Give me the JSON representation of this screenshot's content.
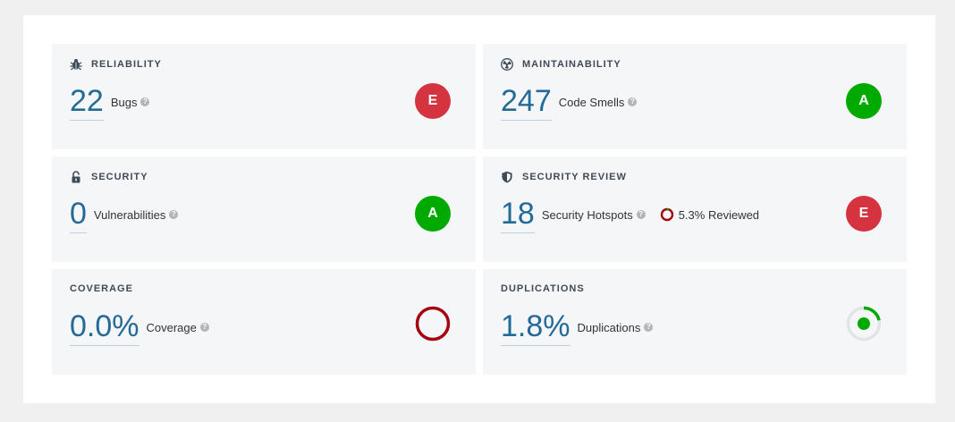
{
  "colors": {
    "rating_e": "#d4333f",
    "rating_a": "#00aa00",
    "accent_value": "#236a97",
    "coverage_ring": "#a4030f",
    "duplication_active": "#00aa00",
    "duplication_track": "#e4e4e4"
  },
  "cards": {
    "reliability": {
      "title": "RELIABILITY",
      "icon": "bug-icon",
      "value": "22",
      "label": "Bugs",
      "rating": "E"
    },
    "maintainability": {
      "title": "MAINTAINABILITY",
      "icon": "radioactive-icon",
      "value": "247",
      "label": "Code Smells",
      "rating": "A"
    },
    "security": {
      "title": "SECURITY",
      "icon": "unlocked-padlock-icon",
      "value": "0",
      "label": "Vulnerabilities",
      "rating": "A"
    },
    "security_review": {
      "title": "SECURITY REVIEW",
      "icon": "shield-icon",
      "value": "18",
      "label": "Security Hotspots",
      "reviewed_text": "5.3% Reviewed",
      "reviewed_fraction": 0.053,
      "rating": "E"
    },
    "coverage": {
      "title": "COVERAGE",
      "value": "0.0%",
      "label": "Coverage",
      "coverage_fraction": 0.0
    },
    "duplications": {
      "title": "DUPLICATIONS",
      "value": "1.8%",
      "label": "Duplications",
      "duplication_fraction": 0.018
    }
  }
}
